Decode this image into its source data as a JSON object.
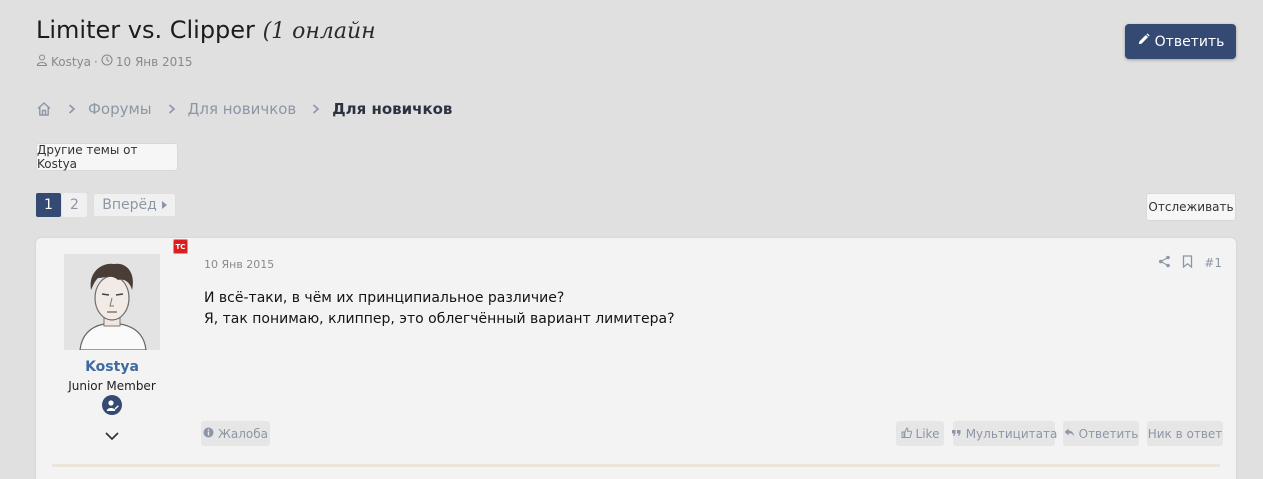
{
  "thread": {
    "title": "Limiter vs. Clipper",
    "online": "(1 онлайн",
    "author": "Kostya",
    "separator": "·",
    "date": "10 Янв 2015"
  },
  "reply_button_label": "Ответить",
  "breadcrumb": {
    "items": [
      "Форумы",
      "Для новичков"
    ],
    "current": "Для новичков"
  },
  "other_threads_label": "Другие темы от Kostya",
  "pagination": {
    "pages": [
      "1",
      "2"
    ],
    "active": "1",
    "next_label": "Вперёд"
  },
  "watch_label": "Отслеживать",
  "post": {
    "badge": "TC",
    "username": "Kostya",
    "user_title": "Junior Member",
    "date": "10 Янв 2015",
    "number": "#1",
    "lines": [
      "И всё-таки, в чём их принципиальное различие?",
      "Я, так понимаю, клиппер, это облегчённый вариант лимитера?"
    ],
    "actions": {
      "report": "Жалоба",
      "like": "Like",
      "multiquote": "Мультицитата",
      "reply": "Ответить",
      "nick_reply": "Ник в ответ"
    }
  },
  "colors": {
    "accent": "#354a73",
    "username": "#3f6aa0",
    "badge": "#d91f1f",
    "background": "#e0e0e0"
  },
  "icons": [
    "user-icon",
    "clock-icon",
    "pencil-icon",
    "home-icon",
    "chevron-right-icon",
    "share-icon",
    "bookmark-icon",
    "info-icon",
    "thumbs-up-icon",
    "quote-icon",
    "reply-icon",
    "chevron-down-icon",
    "user-edit-icon"
  ]
}
